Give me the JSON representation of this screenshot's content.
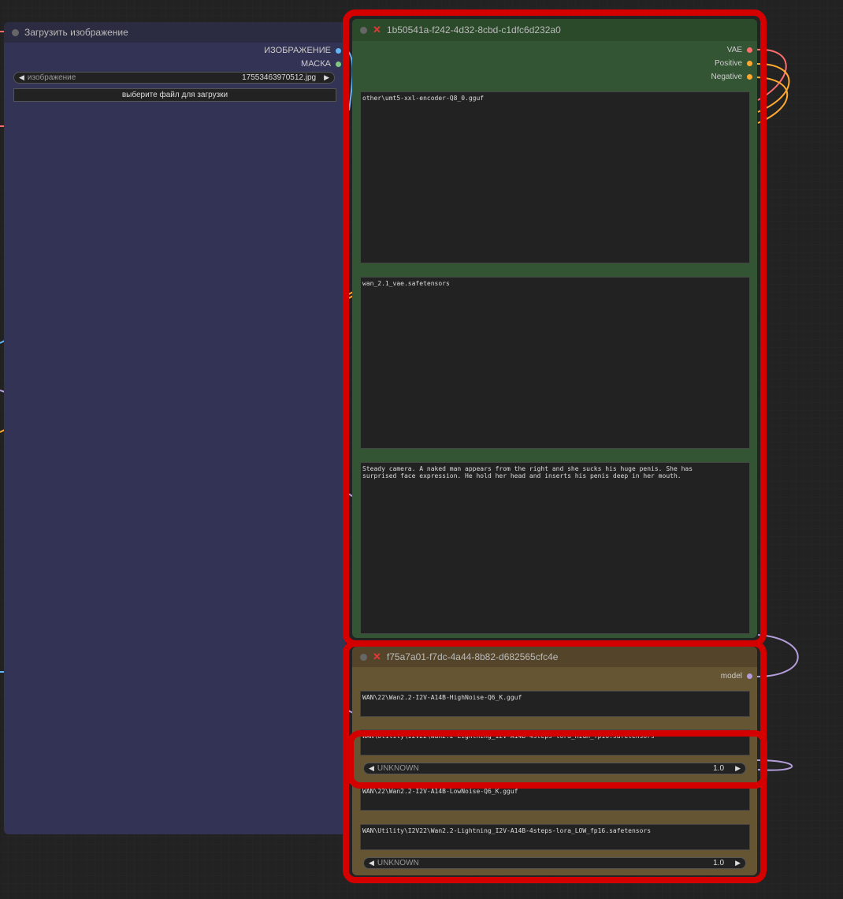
{
  "load_image_node": {
    "title": "Загрузить изображение",
    "outputs": [
      {
        "label": "ИЗОБРАЖЕНИЕ",
        "color": "#64b5f6"
      },
      {
        "label": "МАСКА",
        "color": "#81c784"
      }
    ],
    "image_widget": {
      "label": "изображение",
      "value": "17553463970512.jpg"
    },
    "upload_button": "выберите файл для загрузки"
  },
  "text_node": {
    "title": "1b50541a-f242-4d32-8cbd-c1dfc6d232a0",
    "outputs": [
      {
        "label": "VAE",
        "color": "#ff6e6e"
      },
      {
        "label": "Positive",
        "color": "#ffa931"
      },
      {
        "label": "Negative",
        "color": "#ffa931"
      }
    ],
    "text_encoder": "other\\umt5-xxl-encoder-Q8_0.gguf",
    "vae": "wan_2.1_vae.safetensors",
    "prompt": "Steady camera. A naked man appears from the right and she sucks his huge penis. She has\nsurprised face expression. He hold her head and inserts his penis deep in her mouth."
  },
  "model_node": {
    "title": "f75a7a01-f7dc-4a44-8b82-d682565cfc4e",
    "output": {
      "label": "model",
      "color": "#b39ddb"
    },
    "high_model": "WAN\\22\\Wan2.2-I2V-A14B-HighNoise-Q6_K.gguf",
    "high_lora": "WAN\\Utility\\I2V22\\Wan2.2-Lightning_I2V-A14B-4steps-lora_HIGH_fp16.safetensors",
    "high_strength": {
      "label": "UNKNOWN",
      "value": "1.0"
    },
    "low_model": "WAN\\22\\Wan2.2-I2V-A14B-LowNoise-Q6_K.gguf",
    "low_lora": "WAN\\Utility\\I2V22\\Wan2.2-Lightning_I2V-A14B-4steps-lora_LOW_fp16.safetensors",
    "low_strength": {
      "label": "UNKNOWN",
      "value": "1.0"
    }
  }
}
